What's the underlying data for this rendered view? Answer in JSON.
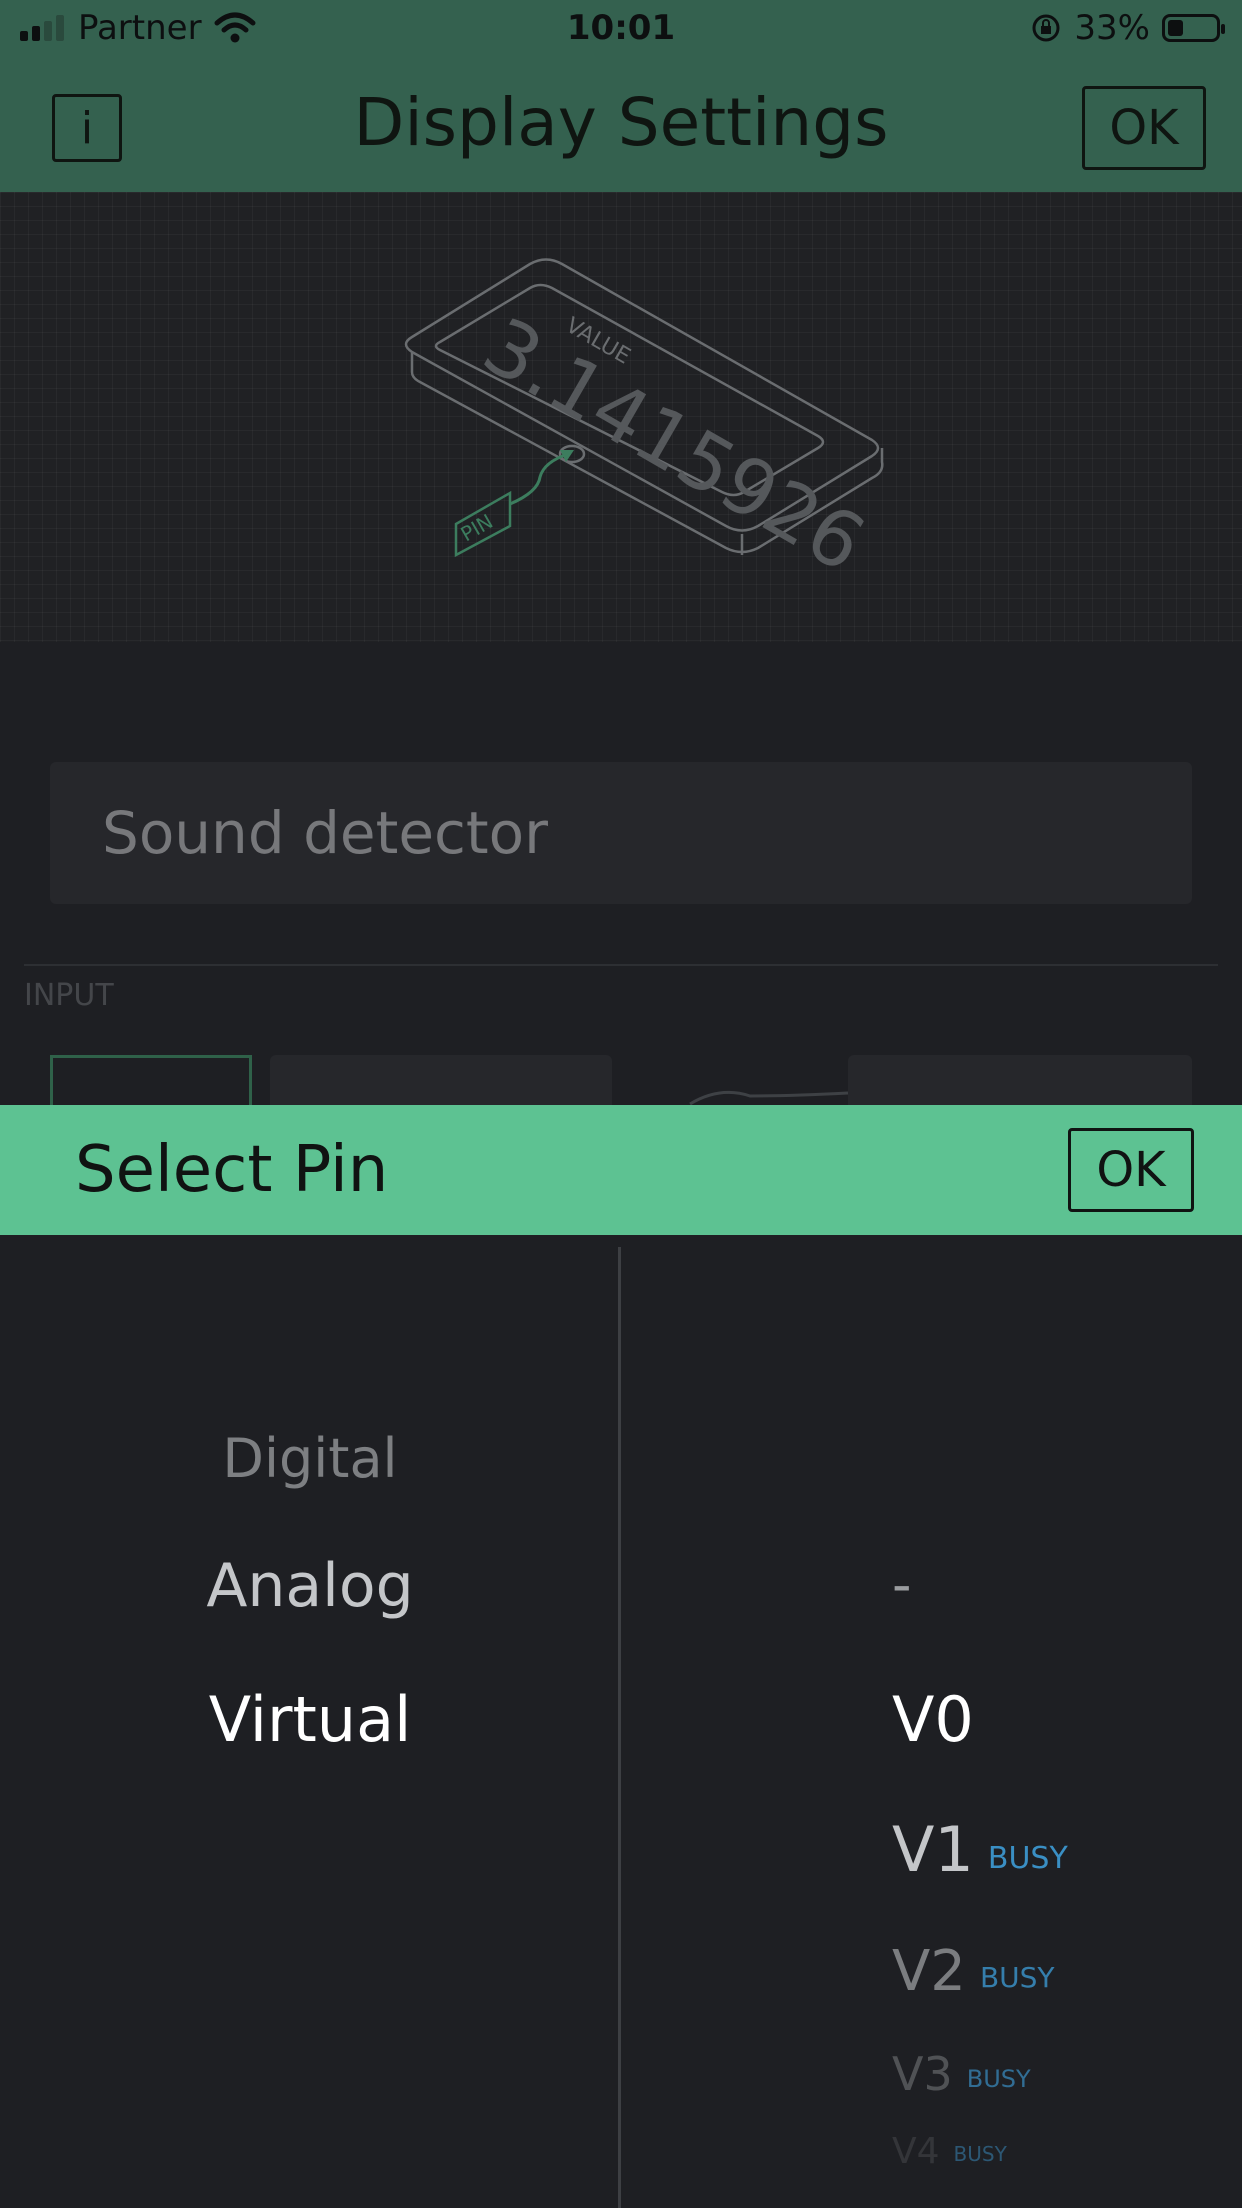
{
  "status_bar": {
    "carrier": "Partner",
    "time": "10:01",
    "battery": "33%",
    "battery_level": 0.33
  },
  "header": {
    "info_label": "i",
    "title": "Display Settings",
    "ok_label": "OK"
  },
  "preview": {
    "value_label": "VALUE",
    "value": "3.1415926",
    "pin_label": "PIN"
  },
  "name_field": {
    "value": "Sound detector"
  },
  "input_section": {
    "label": "INPUT"
  },
  "pin_sheet": {
    "title": "Select Pin",
    "ok_label": "OK",
    "types": [
      "Digital",
      "Analog",
      "Virtual"
    ],
    "selected_type": "Virtual",
    "pins": [
      {
        "label": "-",
        "busy": ""
      },
      {
        "label": "V0",
        "busy": ""
      },
      {
        "label": "V1",
        "busy": "BUSY"
      },
      {
        "label": "V2",
        "busy": "BUSY"
      },
      {
        "label": "V3",
        "busy": "BUSY"
      },
      {
        "label": "V4",
        "busy": "BUSY"
      }
    ],
    "selected_pin": "V0"
  },
  "colors": {
    "header_bg": "#34614f",
    "sheet_accent": "#5dc292",
    "busy_text": "#3a8fc4",
    "background": "#1e1f23"
  },
  "icons": [
    "signal-icon",
    "wifi-icon",
    "rotation-lock-icon",
    "battery-icon",
    "info-icon"
  ]
}
